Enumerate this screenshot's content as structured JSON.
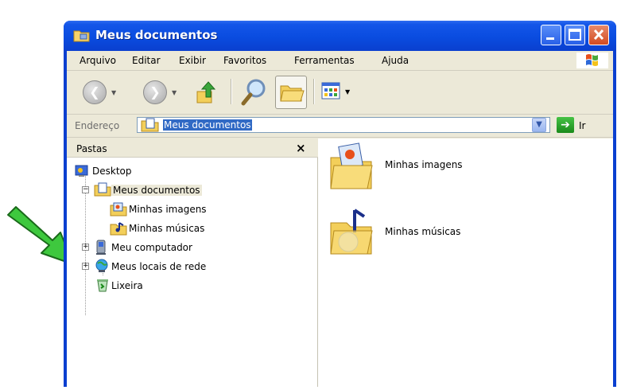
{
  "window": {
    "title": "Meus documentos"
  },
  "menu": {
    "items": [
      "Arquivo",
      "Editar",
      "Exibir",
      "Favoritos",
      "Ferramentas",
      "Ajuda"
    ]
  },
  "toolbar": {
    "buttons": [
      "back-button",
      "forward-button",
      "up-button",
      "search-button",
      "folders-button",
      "views-button"
    ]
  },
  "address": {
    "label": "Endereço",
    "value": "Meus documentos",
    "go_label": "Ir"
  },
  "folders_pane": {
    "header": "Pastas",
    "close": "×",
    "tree": [
      {
        "label": "Desktop",
        "level": 0
      },
      {
        "label": "Meus documentos",
        "level": 1,
        "expanded": true,
        "selected": true
      },
      {
        "label": "Minhas imagens",
        "level": 2
      },
      {
        "label": "Minhas músicas",
        "level": 2
      },
      {
        "label": "Meu computador",
        "level": 1,
        "expandable": true
      },
      {
        "label": "Meus locais de rede",
        "level": 1,
        "expandable": true
      },
      {
        "label": "Lixeira",
        "level": 1
      }
    ]
  },
  "content": {
    "items": [
      {
        "label": "Minhas imagens",
        "icon": "pictures-folder-icon"
      },
      {
        "label": "Minhas músicas",
        "icon": "music-folder-icon"
      }
    ]
  },
  "colors": {
    "titlebar": "#0a4ce0",
    "selection": "#316ac5",
    "chrome": "#ece9d8",
    "annotation_arrow": "#3ec83e"
  }
}
